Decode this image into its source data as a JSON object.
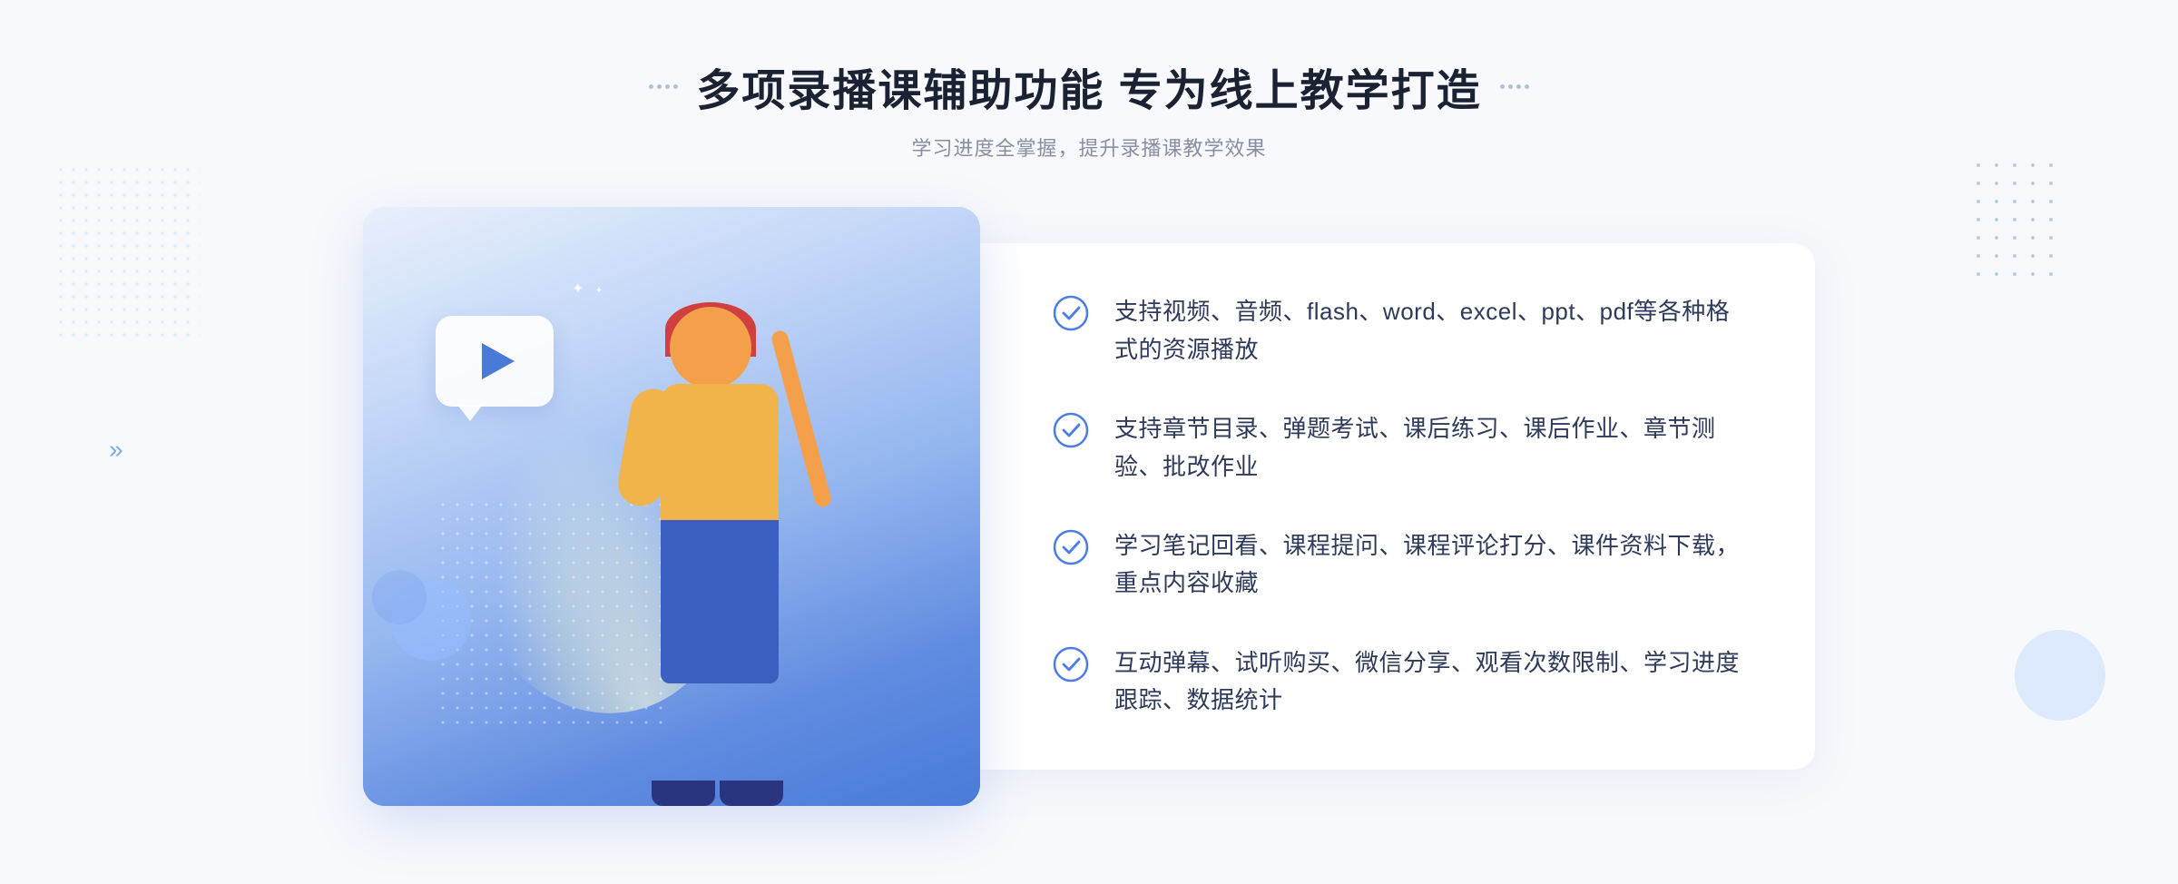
{
  "header": {
    "main_title": "多项录播课辅助功能 专为线上教学打造",
    "sub_title": "学习进度全掌握，提升录播课教学效果"
  },
  "features": [
    {
      "id": 1,
      "text": "支持视频、音频、flash、word、excel、ppt、pdf等各种格式的资源播放"
    },
    {
      "id": 2,
      "text": "支持章节目录、弹题考试、课后练习、课后作业、章节测验、批改作业"
    },
    {
      "id": 3,
      "text": "学习笔记回看、课程提问、课程评论打分、课件资料下载，重点内容收藏"
    },
    {
      "id": 4,
      "text": "互动弹幕、试听购买、微信分享、观看次数限制、学习进度跟踪、数据统计"
    }
  ],
  "colors": {
    "accent": "#4a7de8",
    "title": "#1a2233",
    "subtitle": "#888fa3",
    "feature_text": "#2d3a5a",
    "check_color": "#4a7de8"
  }
}
